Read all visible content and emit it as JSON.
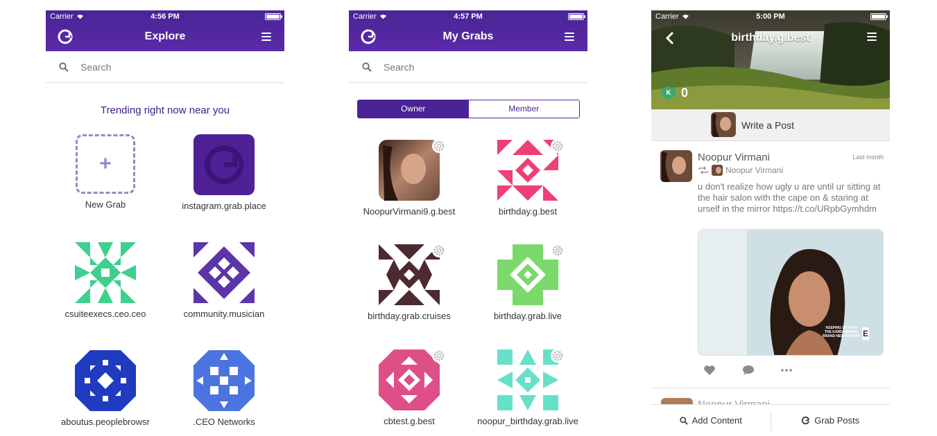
{
  "explore": {
    "status": {
      "carrier": "Carrier",
      "time": "4:56 PM"
    },
    "title": "Explore",
    "search_placeholder": "Search",
    "trending": "Trending right now near you",
    "grabs": [
      {
        "label": "New Grab"
      },
      {
        "label": "instagram.grab.place"
      },
      {
        "label": "csuiteexecs.ceo.ceo"
      },
      {
        "label": "community.musician"
      },
      {
        "label": "aboutus.peoplebrowsr"
      },
      {
        "label": ".CEO Networks"
      }
    ],
    "colors": {
      "csuite": "#3fcf8e",
      "community": "#5a36a8",
      "aboutus": "#1f3bbf",
      "ceo": "#4c74e0"
    }
  },
  "mygrabs": {
    "status": {
      "carrier": "Carrier",
      "time": "4:57 PM"
    },
    "title": "My Grabs",
    "search_placeholder": "Search",
    "segments": {
      "owner": "Owner",
      "member": "Member",
      "selected": "Owner"
    },
    "grabs": [
      {
        "label": "NoopurVirmani9.g.best"
      },
      {
        "label": "birthday.g.best"
      },
      {
        "label": "birthday.grab.cruises"
      },
      {
        "label": "birthday.grab.live"
      },
      {
        "label": "cbtest.g.best"
      },
      {
        "label": "noopur_birthday.grab.live"
      }
    ],
    "colors": {
      "birthday_gbest": "#ef3f74",
      "cruises": "#4b2a30",
      "live": "#7bd96b",
      "cbtest": "#dd4f86",
      "noopur": "#66e0c8"
    }
  },
  "detail": {
    "status": {
      "carrier": "Carrier",
      "time": "5:00 PM"
    },
    "title": "birthday.g.best",
    "karma_count": "0",
    "write_post": "Write a Post",
    "post": {
      "author": "Noopur Virmani",
      "time": "Last month",
      "regrab_by": "Noopur Virmani",
      "text": "u don't realize how ugly u are until ur sitting at the hair salon with the cape on & staring at urself in the mirror https://t.co/URpbGymhdm",
      "image_caption": "KEEPING UP WITH THE KARDASHIANS BRAND NEW #KUWTK"
    },
    "next_author": "Noopur Virmani",
    "bottom": {
      "add_content": "Add Content",
      "grab_posts": "Grab Posts"
    }
  }
}
